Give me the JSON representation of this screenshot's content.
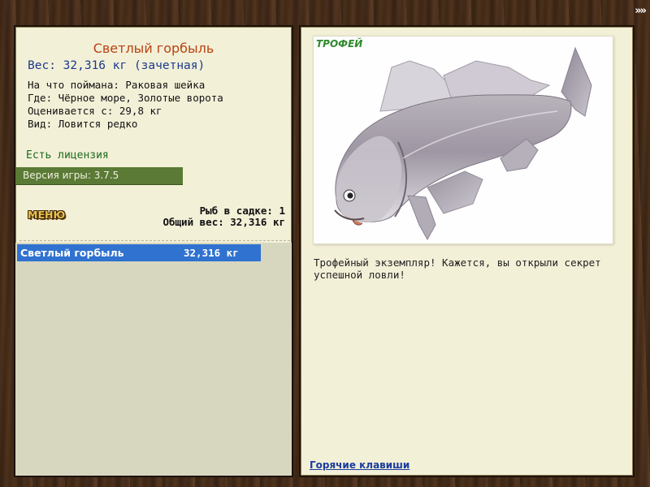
{
  "header": {
    "more_icon": "»»"
  },
  "catch": {
    "fish_name": "Светлый горбыль",
    "weight_line": "Вес: 32,316 кг (зачетная)",
    "bait_line": "На что поймана: Раковая шейка",
    "location_line": "Где: Чёрное море, Золотые ворота",
    "value_line": "Оценивается с: 29,8 кг",
    "rarity_line": "Вид: Ловится редко",
    "license": "Есть лицензия",
    "version": "Версия игры: 3.7.5"
  },
  "menu": {
    "label": "МЕНЮ"
  },
  "keepnet": {
    "count_line": "Рыб в садке: 1",
    "total_line": "Общий вес: 32,316 кг",
    "items": [
      {
        "name": "Светлый горбыль",
        "weight": "32,316 кг"
      }
    ]
  },
  "trophy": {
    "badge": "ТРОФЕЙ",
    "description": "Трофейный экземпляр! Кажется, вы открыли секрет успешной ловли!"
  },
  "footer": {
    "hotkeys": "Горячие клавиши"
  },
  "colors": {
    "list_selected": "#2f72d0",
    "version_bar": "#5a7a35",
    "fish_name": "#b84312",
    "weight": "#1a3a8c",
    "license": "#1d6b1d"
  }
}
